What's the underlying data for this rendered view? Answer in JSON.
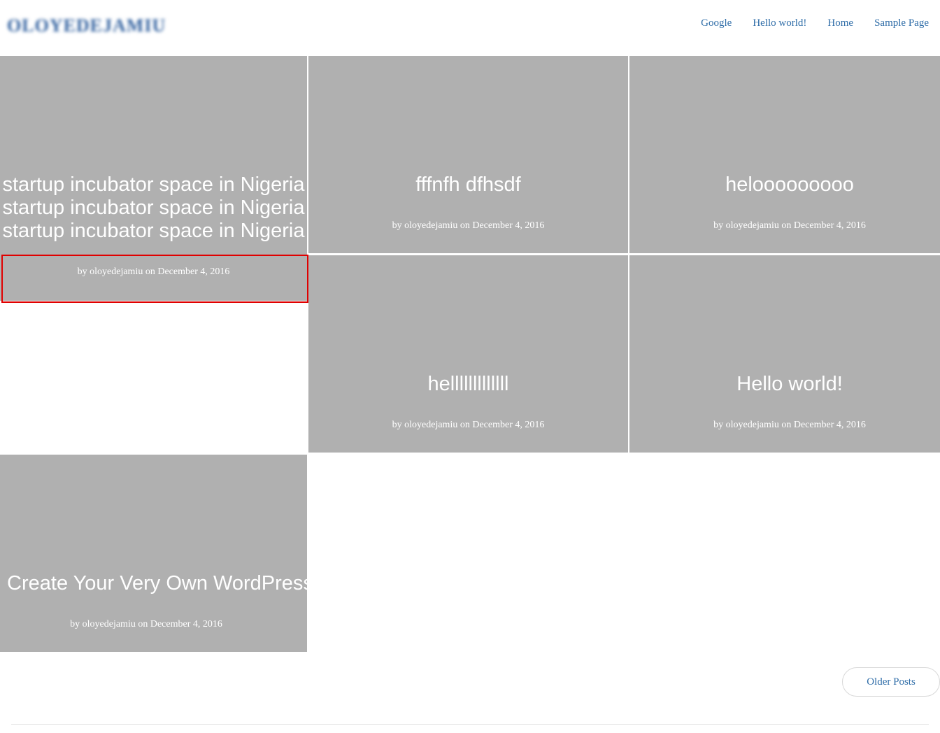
{
  "header": {
    "logo_text": "OLOYEDEJAMIU",
    "nav": [
      {
        "label": "Google"
      },
      {
        "label": "Hello world!"
      },
      {
        "label": "Home"
      },
      {
        "label": "Sample Page"
      }
    ]
  },
  "posts": [
    {
      "title_lines": [
        "startup incubator space in Nigeria",
        "startup incubator space in Nigeria",
        "startup incubator space in Nigeria"
      ],
      "meta": "by oloyedejamiu on December 4, 2016"
    },
    {
      "title": "fffnfh dfhsdf",
      "meta": "by oloyedejamiu on December 4, 2016"
    },
    {
      "title": "helooooooooo",
      "meta": "by oloyedejamiu on December 4, 2016"
    },
    {
      "title": "helllllllllllll",
      "meta": "by oloyedejamiu on December 4, 2016"
    },
    {
      "title": "Hello world!",
      "meta": "by oloyedejamiu on December 4, 2016"
    },
    {
      "title": "Create Your Very Own WordPress",
      "meta": "by oloyedejamiu on December 4, 2016"
    }
  ],
  "pagination": {
    "older_label": "Older Posts"
  },
  "colors": {
    "tile_bg": "#b0b0b0",
    "link": "#2f6da8",
    "highlight": "#e00000"
  }
}
